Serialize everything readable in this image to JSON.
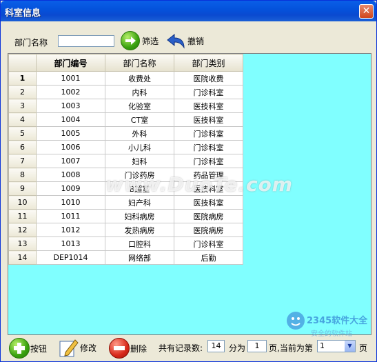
{
  "window": {
    "title": "科室信息",
    "close_glyph": "✕"
  },
  "toolbar": {
    "dept_label": "部门名称",
    "dept_value": "",
    "filter_label": "筛选",
    "undo_label": "撤销"
  },
  "grid": {
    "columns": [
      "部门编号",
      "部门名称",
      "部门类别"
    ],
    "rows": [
      {
        "n": "1",
        "code": "1001",
        "name": "收费处",
        "type": "医院收费"
      },
      {
        "n": "2",
        "code": "1002",
        "name": "内科",
        "type": "门诊科室"
      },
      {
        "n": "3",
        "code": "1003",
        "name": "化验室",
        "type": "医技科室"
      },
      {
        "n": "4",
        "code": "1004",
        "name": "CT室",
        "type": "医技科室"
      },
      {
        "n": "5",
        "code": "1005",
        "name": "外科",
        "type": "门诊科室"
      },
      {
        "n": "6",
        "code": "1006",
        "name": "小儿科",
        "type": "门诊科室"
      },
      {
        "n": "7",
        "code": "1007",
        "name": "妇科",
        "type": "门诊科室"
      },
      {
        "n": "8",
        "code": "1008",
        "name": "门诊药房",
        "type": "药品管理"
      },
      {
        "n": "9",
        "code": "1009",
        "name": "B超室",
        "type": "医技科室"
      },
      {
        "n": "10",
        "code": "1010",
        "name": "妇产科",
        "type": "医技科室"
      },
      {
        "n": "11",
        "code": "1011",
        "name": "妇科病房",
        "type": "医院病房"
      },
      {
        "n": "12",
        "code": "1012",
        "name": "发热病房",
        "type": "医院病房"
      },
      {
        "n": "13",
        "code": "1013",
        "name": "口腔科",
        "type": "门诊科室"
      },
      {
        "n": "14",
        "code": "DEP1014",
        "name": "网络部",
        "type": "后勤"
      }
    ]
  },
  "footer": {
    "add_label": "按钮",
    "edit_label": "修改",
    "delete_label": "删除",
    "total_label": "共有记录数:",
    "total_value": "14",
    "split_label": "分为",
    "pages_value": "1",
    "page_current_label": "页,当前为第",
    "current_page": "1",
    "page_suffix": "页"
  },
  "watermark": {
    "text": "www.DuoTe.com",
    "logo_text": "2345软件大全",
    "logo_sub": "安全的软件站"
  },
  "colors": {
    "grid_bg": "#80ffff",
    "title_bar": "#0453dc"
  }
}
